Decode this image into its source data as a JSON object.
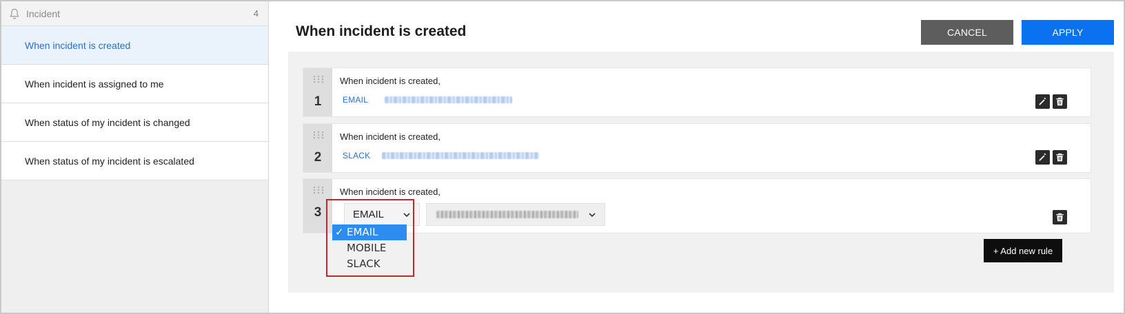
{
  "sidebar": {
    "header": {
      "label": "Incident",
      "count": "4"
    },
    "items": [
      {
        "label": "When incident is created",
        "active": true
      },
      {
        "label": "When incident is assigned to me"
      },
      {
        "label": "When status of my incident is changed"
      },
      {
        "label": "When status of my incident is escalated"
      }
    ]
  },
  "main": {
    "title": "When incident is created",
    "cancel_label": "CANCEL",
    "apply_label": "APPLY",
    "rules": [
      {
        "number": "1",
        "condition": "When incident is created,",
        "type": "EMAIL"
      },
      {
        "number": "2",
        "condition": "When incident is created,",
        "type": "SLACK"
      },
      {
        "number": "3",
        "condition": "When incident is created,",
        "selected_type": "EMAIL",
        "type_options": [
          "EMAIL",
          "MOBILE",
          "SLACK"
        ]
      }
    ],
    "add_rule_label": "+ Add new rule"
  },
  "colors": {
    "accent": "#0a72f0",
    "cancel": "#5d5d5d",
    "active_item_bg": "#eaf3fb",
    "active_item_text": "#2a6fd0",
    "highlight": "#c62828",
    "dropdown_selected": "#2d8cf0"
  },
  "icons": [
    "bell-icon",
    "drag-handle-icon",
    "edit-icon",
    "trash-icon",
    "chevron-down-icon",
    "check-icon"
  ]
}
